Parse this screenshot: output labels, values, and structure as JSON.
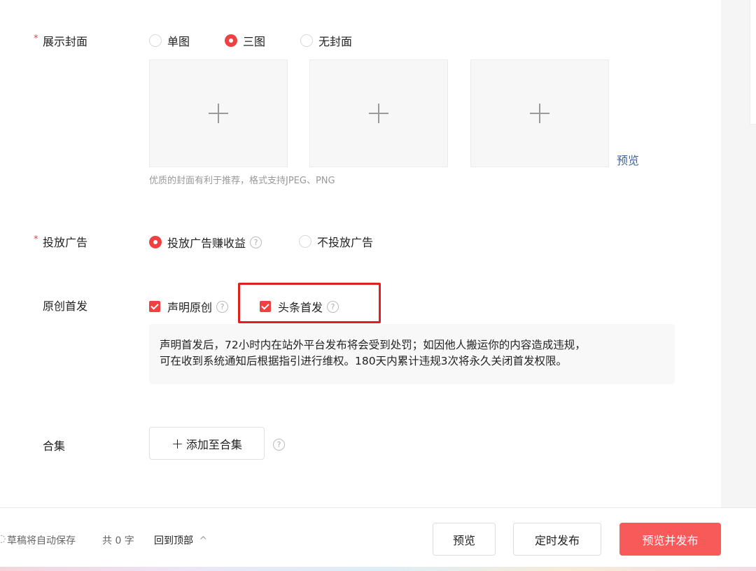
{
  "cover": {
    "label": "展示封面",
    "options": [
      "单图",
      "三图",
      "无封面"
    ],
    "preview": "预览",
    "hint": "优质的封面有利于推荐，格式支持JPEG、PNG"
  },
  "ads": {
    "label": "投放广告",
    "options": [
      "投放广告赚收益",
      "不投放广告"
    ]
  },
  "original": {
    "label": "原创首发",
    "checks": [
      "声明原创",
      "头条首发"
    ],
    "notice": [
      "声明首发后，72小时内在站外平台发布将会受到处罚；如因他人搬运你的内容造成违规，",
      "可在收到系统通知后根据指引进行维权。180天内累计违规3次将永久关闭首发权限。"
    ]
  },
  "collection": {
    "label": "合集",
    "add_button": "添加至合集"
  },
  "footer": {
    "autosave": "草稿将自动保存",
    "word_count": "共 0 字",
    "back_top": "回到顶部",
    "preview": "预览",
    "schedule": "定时发布",
    "publish": "预览并发布"
  },
  "colors": {
    "accent": "#f04142",
    "primary_button": "#f85959",
    "link": "#406599"
  }
}
